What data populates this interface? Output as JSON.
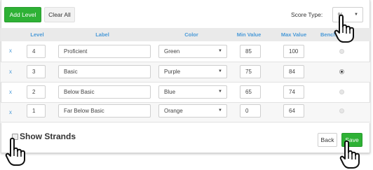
{
  "toolbar": {
    "add_level_label": "Add Level",
    "clear_all_label": "Clear All",
    "score_type_label": "Score Type:",
    "score_type_value": "%"
  },
  "table": {
    "headers": [
      "Level",
      "Label",
      "Color",
      "Min Value",
      "Max Value",
      "Bench"
    ],
    "remove_symbol": "x",
    "rows": [
      {
        "level": "4",
        "label": "Proficient",
        "color": "Green",
        "min": "85",
        "max": "100",
        "benchmark": false
      },
      {
        "level": "3",
        "label": "Basic",
        "color": "Purple",
        "min": "75",
        "max": "84",
        "benchmark": true
      },
      {
        "level": "2",
        "label": "Below Basic",
        "color": "Blue",
        "min": "65",
        "max": "74",
        "benchmark": false
      },
      {
        "level": "1",
        "label": "Far Below Basic",
        "color": "Orange",
        "min": "0",
        "max": "64",
        "benchmark": false
      }
    ]
  },
  "footer": {
    "show_strands_label": "Show Strands",
    "back_label": "Back",
    "save_label": "Save"
  },
  "colors": {
    "accent_blue": "#4a9ad8",
    "button_green": "#2eb135"
  },
  "icons": {
    "cursor": "hand-pointer-icon",
    "dropdown": "caret-down-icon"
  }
}
